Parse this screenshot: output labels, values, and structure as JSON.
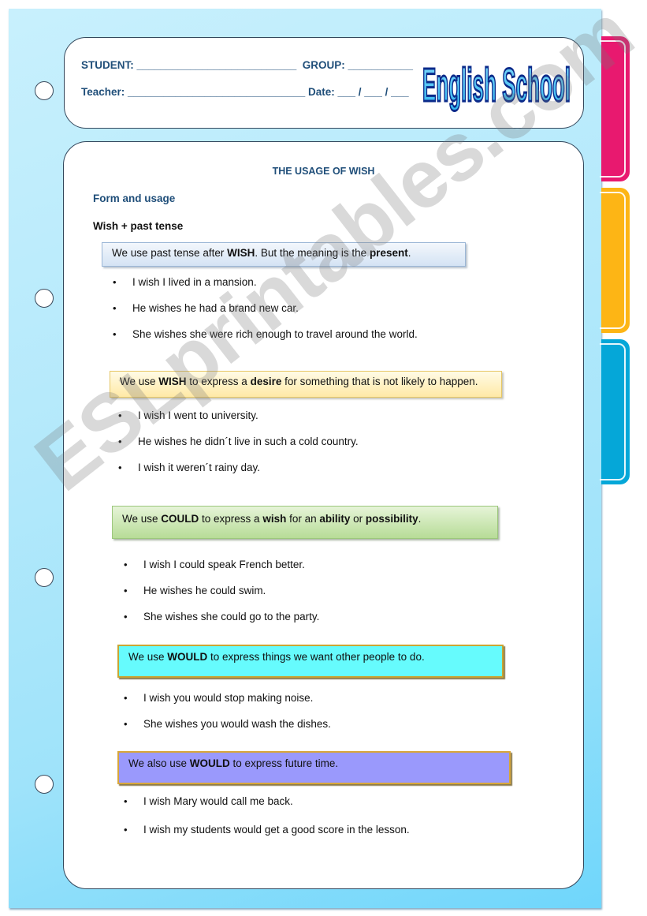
{
  "header": {
    "student_line": "STUDENT: ___________________________  GROUP: ___________",
    "teacher_line": "Teacher: ______________________________ Date: ___ / ___ / ___",
    "logo_text": "English School"
  },
  "tabs": {
    "colors": [
      "#e8196f",
      "#fdb515",
      "#05a7d8"
    ]
  },
  "content": {
    "title": "THE USAGE OF WISH",
    "section_heading": "Form and usage",
    "subheading": "Wish + past tense",
    "rules": [
      {
        "parts": [
          {
            "t": "We use past tense after ",
            "b": false
          },
          {
            "t": "WISH",
            "b": true
          },
          {
            "t": ". But the meaning is the ",
            "b": false
          },
          {
            "t": "present",
            "b": true
          },
          {
            "t": ".",
            "b": false
          }
        ],
        "examples": [
          "I wish I lived in a mansion.",
          "He wishes he had a brand new car.",
          "She wishes she were rich enough to travel around the world."
        ]
      },
      {
        "parts": [
          {
            "t": "We use ",
            "b": false
          },
          {
            "t": "WISH",
            "b": true
          },
          {
            "t": " to express a ",
            "b": false
          },
          {
            "t": "desire",
            "b": true
          },
          {
            "t": " for something that is not likely to happen.",
            "b": false
          }
        ],
        "examples": [
          "I wish I went to university.",
          "He wishes he didn´t live in such a cold country.",
          "I wish it weren´t rainy day."
        ]
      },
      {
        "parts": [
          {
            "t": "We use ",
            "b": false
          },
          {
            "t": "COULD",
            "b": true
          },
          {
            "t": " to express a ",
            "b": false
          },
          {
            "t": "wish",
            "b": true
          },
          {
            "t": " for an ",
            "b": false
          },
          {
            "t": "ability",
            "b": true
          },
          {
            "t": " or ",
            "b": false
          },
          {
            "t": "possibility",
            "b": true
          },
          {
            "t": ".",
            "b": false
          }
        ],
        "examples": [
          "I wish I could speak French better.",
          "He wishes he could swim.",
          "She wishes she could go to the party."
        ]
      },
      {
        "parts": [
          {
            "t": "We use ",
            "b": false
          },
          {
            "t": "WOULD",
            "b": true
          },
          {
            "t": " to express things we want other people to do.",
            "b": false
          }
        ],
        "examples": [
          "I wish you would stop making noise.",
          "She wishes you would wash the dishes."
        ]
      },
      {
        "parts": [
          {
            "t": "We also use ",
            "b": false
          },
          {
            "t": "WOULD",
            "b": true
          },
          {
            "t": " to express future time.",
            "b": false
          }
        ],
        "examples": [
          "I wish Mary would call me back.",
          "I wish my students would get a good score in the lesson."
        ]
      }
    ]
  },
  "watermark": "ESLprintables.com"
}
